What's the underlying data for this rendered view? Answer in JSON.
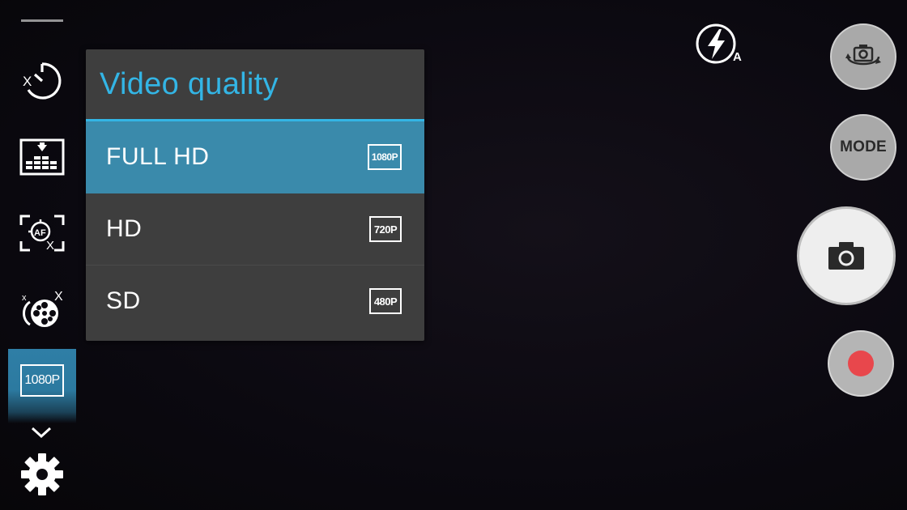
{
  "dialog": {
    "title": "Video quality",
    "options": [
      {
        "label": "FULL HD",
        "badge": "1080P",
        "selected": true
      },
      {
        "label": "HD",
        "badge": "720P",
        "selected": false
      },
      {
        "label": "SD",
        "badge": "480P",
        "selected": false
      }
    ]
  },
  "left_bar": {
    "items": [
      {
        "name": "timer",
        "icon": "timer-off-icon"
      },
      {
        "name": "metering",
        "icon": "metering-icon"
      },
      {
        "name": "autofocus",
        "icon": "af-off-icon"
      },
      {
        "name": "video-effect",
        "icon": "film-reel-off-icon"
      },
      {
        "name": "video-quality",
        "icon": "resolution-1080p-icon",
        "badge": "1080P",
        "selected": true
      }
    ],
    "expand_icon": "chevron-down-icon",
    "settings_icon": "gear-icon"
  },
  "right_bar": {
    "flash_mode": "A",
    "switch_camera_icon": "switch-camera-icon",
    "mode_label": "MODE",
    "shutter_icon": "camera-icon",
    "record_icon": "record-icon"
  },
  "colors": {
    "accent": "#33b5e5",
    "selected_row": "#3a8aab",
    "dialog_bg": "#3e3e3e",
    "record": "#e8474c"
  }
}
